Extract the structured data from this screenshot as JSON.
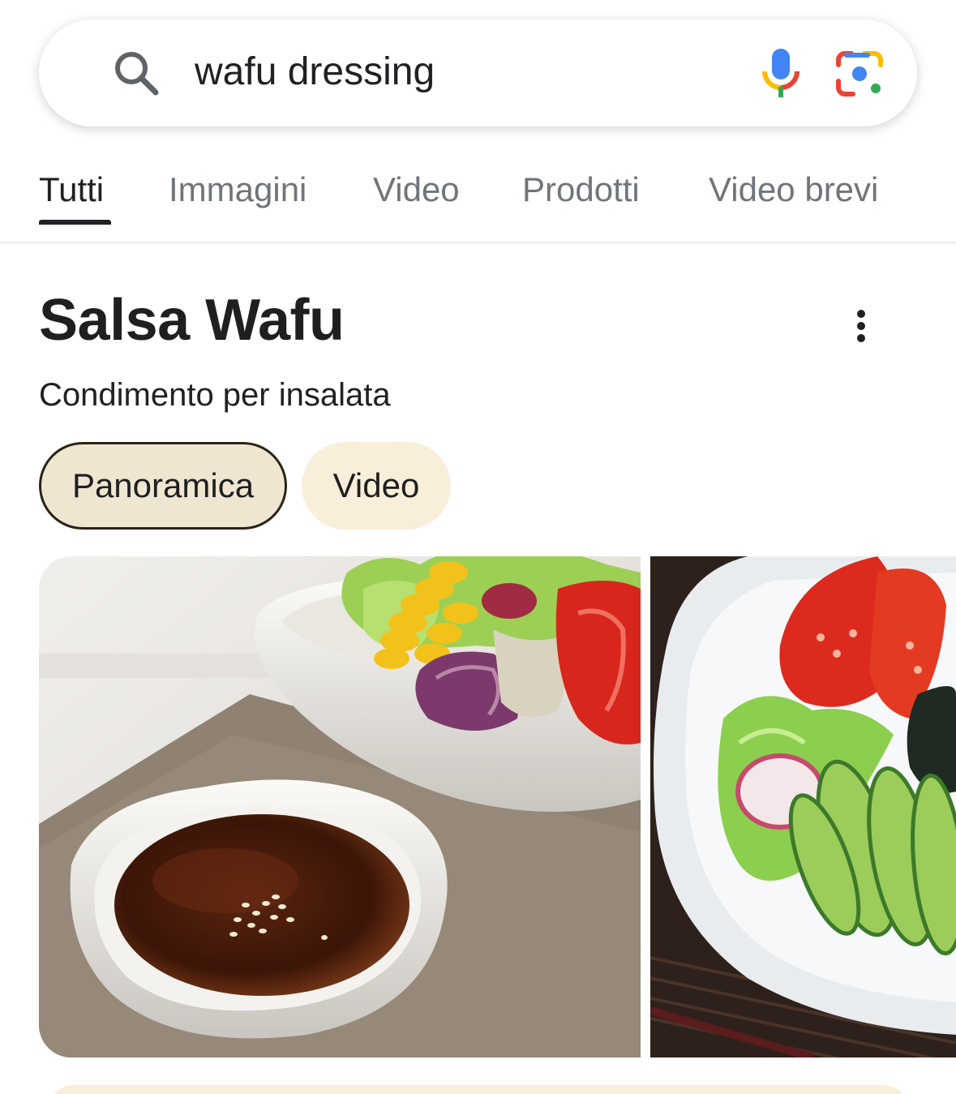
{
  "search": {
    "query": "wafu dressing",
    "icons": {
      "search": "search-icon",
      "voice": "mic-icon",
      "lens": "google-lens-icon"
    }
  },
  "tabs": [
    {
      "label": "Tutti",
      "active": true
    },
    {
      "label": "Immagini",
      "active": false
    },
    {
      "label": "Video",
      "active": false
    },
    {
      "label": "Prodotti",
      "active": false
    },
    {
      "label": "Video brevi",
      "active": false
    }
  ],
  "entity": {
    "title": "Salsa Wafu",
    "subtitle": "Condimento per insalata",
    "more_icon": "more-vert-icon"
  },
  "chips": [
    {
      "label": "Panoramica",
      "selected": true
    },
    {
      "label": "Video",
      "selected": false
    }
  ],
  "images": [
    {
      "subject": "wafu-dressing-bowl-with-salad"
    },
    {
      "subject": "salad-plate-with-tomato-cucumber"
    }
  ],
  "colors": {
    "chip_selected_bg": "#efe6d2",
    "chip_bg": "#f8eed9",
    "text_primary": "#202124",
    "text_secondary": "#70757a"
  }
}
